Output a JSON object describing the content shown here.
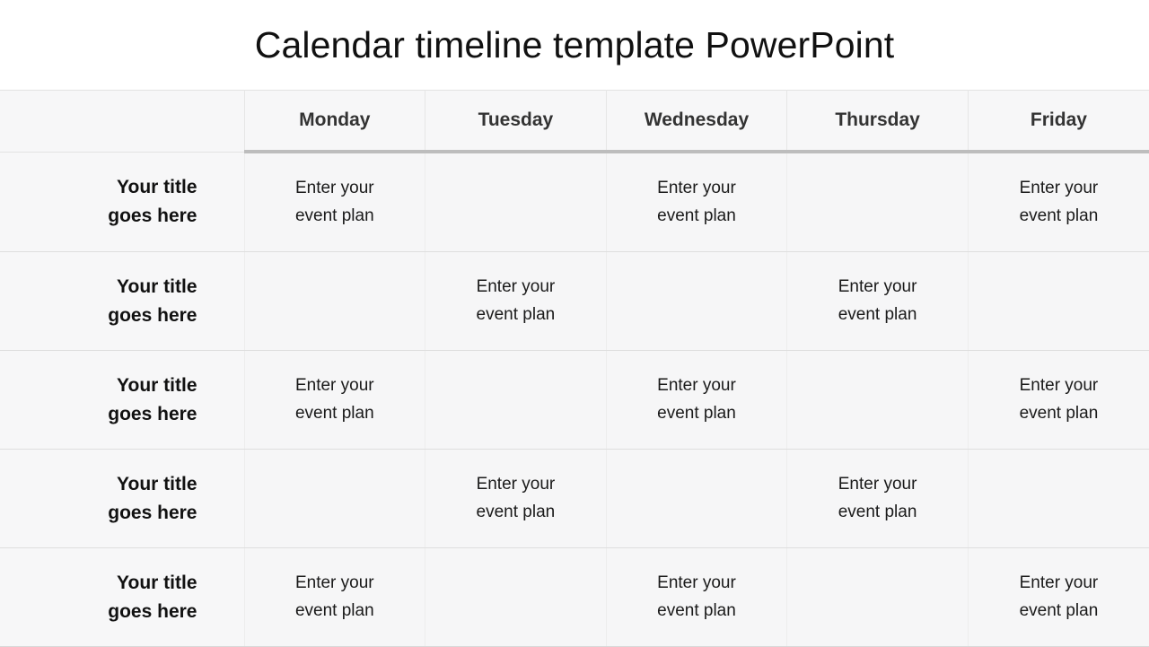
{
  "title": "Calendar timeline template PowerPoint",
  "table": {
    "corner_label": "",
    "day_headers": [
      "Monday",
      "Tuesday",
      "Wednesday",
      "Thursday",
      "Friday"
    ],
    "row_label_text": "Your title\ngoes here",
    "event_text": "Enter your\nevent plan",
    "rows": [
      {
        "label": "Your title\ngoes here",
        "cells": [
          {
            "text": "Enter your\nevent plan",
            "fill": "peach"
          },
          {
            "text": "",
            "fill": "none"
          },
          {
            "text": "Enter your\nevent plan",
            "fill": "green"
          },
          {
            "text": "",
            "fill": "none"
          },
          {
            "text": "Enter your\nevent plan",
            "fill": "peach"
          }
        ]
      },
      {
        "label": "Your title\ngoes here",
        "cells": [
          {
            "text": "",
            "fill": "none"
          },
          {
            "text": "Enter your\nevent plan",
            "fill": "blue"
          },
          {
            "text": "",
            "fill": "none"
          },
          {
            "text": "Enter your\nevent plan",
            "fill": "yellow"
          },
          {
            "text": "",
            "fill": "none"
          }
        ]
      },
      {
        "label": "Your title\ngoes here",
        "cells": [
          {
            "text": "Enter your\nevent plan",
            "fill": "yellow"
          },
          {
            "text": "",
            "fill": "none"
          },
          {
            "text": "Enter your\nevent plan",
            "fill": "peach"
          },
          {
            "text": "",
            "fill": "none"
          },
          {
            "text": "Enter your\nevent plan",
            "fill": "green"
          }
        ]
      },
      {
        "label": "Your title\ngoes here",
        "cells": [
          {
            "text": "",
            "fill": "none"
          },
          {
            "text": "Enter your\nevent plan",
            "fill": "green"
          },
          {
            "text": "",
            "fill": "none"
          },
          {
            "text": "Enter your\nevent plan",
            "fill": "blue"
          },
          {
            "text": "",
            "fill": "none"
          }
        ]
      },
      {
        "label": "Your title\ngoes here",
        "cells": [
          {
            "text": "Enter your\nevent plan",
            "fill": "blue"
          },
          {
            "text": "",
            "fill": "none"
          },
          {
            "text": "Enter your\nevent plan",
            "fill": "yellow"
          },
          {
            "text": "",
            "fill": "none"
          },
          {
            "text": "Enter your\nevent plan",
            "fill": "peach"
          }
        ]
      }
    ]
  },
  "colors": {
    "peach": "#fbe0d0",
    "green": "#eaf1e6",
    "blue": "#dfe7f3",
    "yellow": "#fdefcc",
    "empty_cell": "#f6f6f7",
    "header_background": "#f7f7f8",
    "header_rule": "#bdbdbd",
    "grid_line": "#dedede",
    "title_text": "#111111",
    "header_text": "#333333",
    "cell_text": "#1a1a1a",
    "page_background": "#ffffff"
  }
}
